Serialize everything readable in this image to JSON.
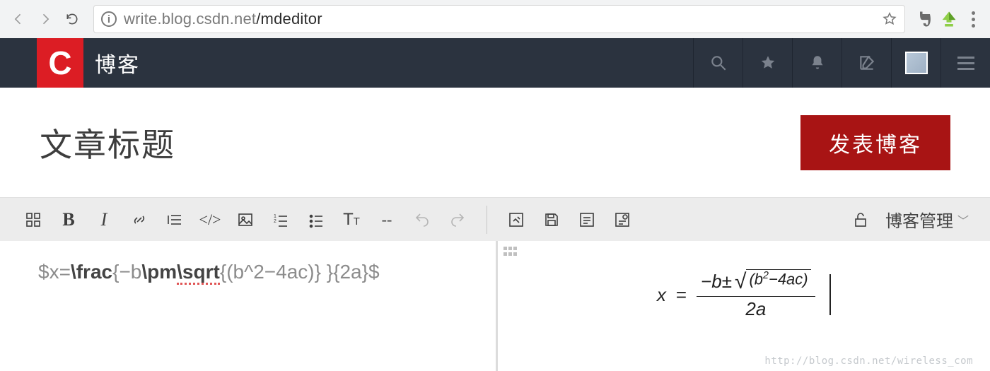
{
  "browser": {
    "url_dim": "write.blog.csdn.net",
    "url_path": "/mdeditor"
  },
  "header": {
    "logo_letter": "C",
    "blog_label": "博客"
  },
  "title_row": {
    "title": "文章标题",
    "publish_label": "发表博客"
  },
  "toolbar": {
    "bold": "B",
    "italic": "I",
    "code": "</>",
    "heading": "T",
    "heading_sub": "T",
    "hr": "--",
    "manage_label": "博客管理",
    "chevron": "﹀"
  },
  "editor": {
    "source_prefix": "$x=",
    "source_frac": "\\frac",
    "source_mid1": "{−b",
    "source_pm": "\\pm",
    "source_sqrt": "\\sqrt",
    "source_mid2": "{(b^2−4ac)} }{2a}$",
    "preview": {
      "lhs": "x",
      "eq": "=",
      "num_prefix": "−b±",
      "radicand": "(b",
      "radicand_sup": "2",
      "radicand_tail": "−4ac)",
      "den": "2a"
    }
  },
  "watermark": "http://blog.csdn.net/wireless_com"
}
